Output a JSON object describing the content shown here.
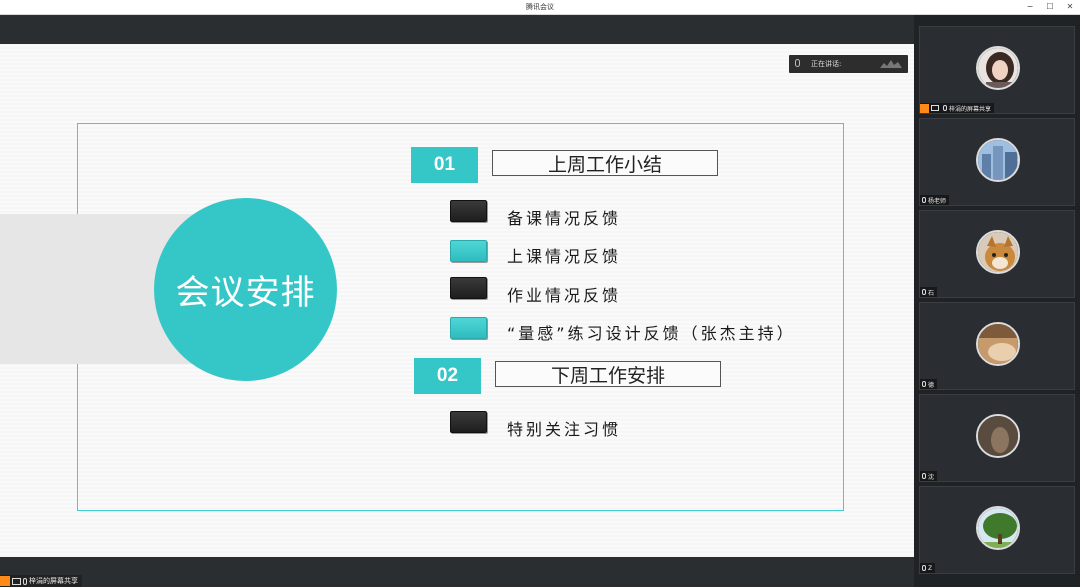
{
  "window": {
    "title": "腾讯会议",
    "controls": [
      "−",
      "☐",
      "✕"
    ]
  },
  "speaking": {
    "label": "正在讲话:"
  },
  "slide": {
    "circle_title": "会议安排",
    "section1": {
      "number": "01",
      "heading": "上周工作小结"
    },
    "section2": {
      "number": "02",
      "heading": "下周工作安排"
    },
    "items": [
      {
        "text": "备课情况反馈",
        "bullet": "dark"
      },
      {
        "text": "上课情况反馈",
        "bullet": "cyan"
      },
      {
        "text": "作业情况反馈",
        "bullet": "dark"
      },
      {
        "text": "“量感”练习设计反馈（张杰主持）",
        "bullet": "cyan"
      }
    ],
    "items2": [
      {
        "text": "特别关注习惯",
        "bullet": "dark"
      }
    ]
  },
  "share_tag": {
    "label": "梓涓的屏幕共享"
  },
  "participants": [
    {
      "name": "梓涓的屏幕共享",
      "avatar": "woman-photo",
      "host": true,
      "sharing": true
    },
    {
      "name": "杨老师",
      "avatar": "city-buildings",
      "host": false,
      "sharing": false
    },
    {
      "name": "石",
      "avatar": "shiba-dog",
      "host": false,
      "sharing": false
    },
    {
      "name": "德",
      "avatar": "hand-photo",
      "host": false,
      "sharing": false
    },
    {
      "name": "沈",
      "avatar": "dim-photo",
      "host": false,
      "sharing": false
    },
    {
      "name": "Z",
      "avatar": "tree-photo",
      "host": false,
      "sharing": false
    }
  ],
  "colors": {
    "accent": "#35c6c8",
    "host": "#ff8a1a"
  }
}
